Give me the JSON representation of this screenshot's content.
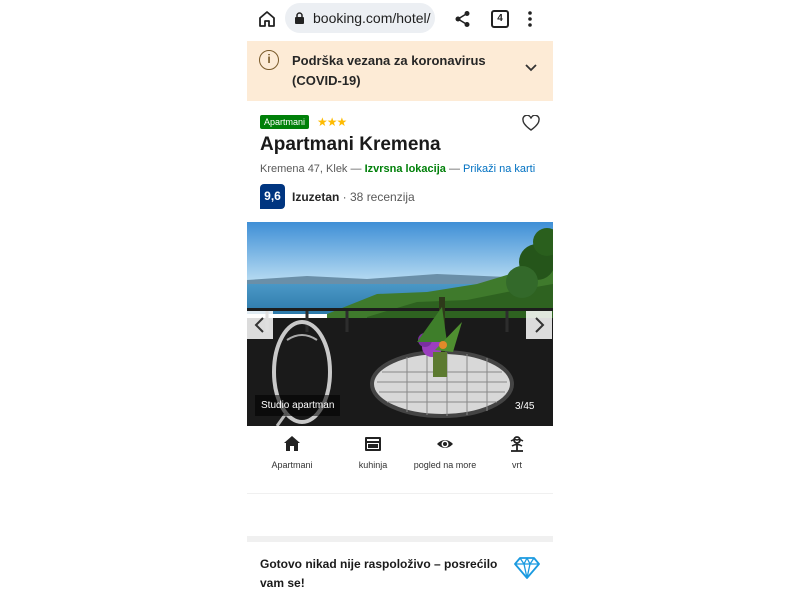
{
  "browser": {
    "url": "booking.com/hotel/",
    "tab_count": "4",
    "icons": [
      "home-icon",
      "lock-icon",
      "share-icon",
      "tabs-icon",
      "kebab-menu-icon"
    ]
  },
  "covid_banner": {
    "text": "Podrška vezana za koronavirus (COVID-19)",
    "icon": "info-icon"
  },
  "property": {
    "type_badge": "Apartmani",
    "stars": "★★★",
    "star_count": 3,
    "title": "Apartmani Kremena",
    "address": "Kremena 47, Klek",
    "separator": " — ",
    "location_label": "Izvrsna lokacija",
    "map_link": "Prikaži na karti",
    "score": "9,6",
    "score_word": "Izuzetan",
    "reviews": " · 38 recenzija"
  },
  "photo": {
    "caption": "Studio apartman",
    "counter": "3/45"
  },
  "facilities": [
    {
      "label": "Apartmani",
      "icon": "home-icon"
    },
    {
      "label": "kuhinja",
      "icon": "kitchen-icon"
    },
    {
      "label": "pogled na more",
      "icon": "eye-icon"
    },
    {
      "label": "vrt",
      "icon": "garden-icon"
    }
  ],
  "promo": {
    "text": "Gotovo nikad nije raspoloživo – posrećilo vam se!",
    "icon": "diamond-icon"
  },
  "colors": {
    "brand_blue": "#003580",
    "link_blue": "#0071c2",
    "green": "#008009",
    "star_yellow": "#febb02",
    "banner_bg": "#fdebd6",
    "diamond": "#1a9ae0"
  }
}
